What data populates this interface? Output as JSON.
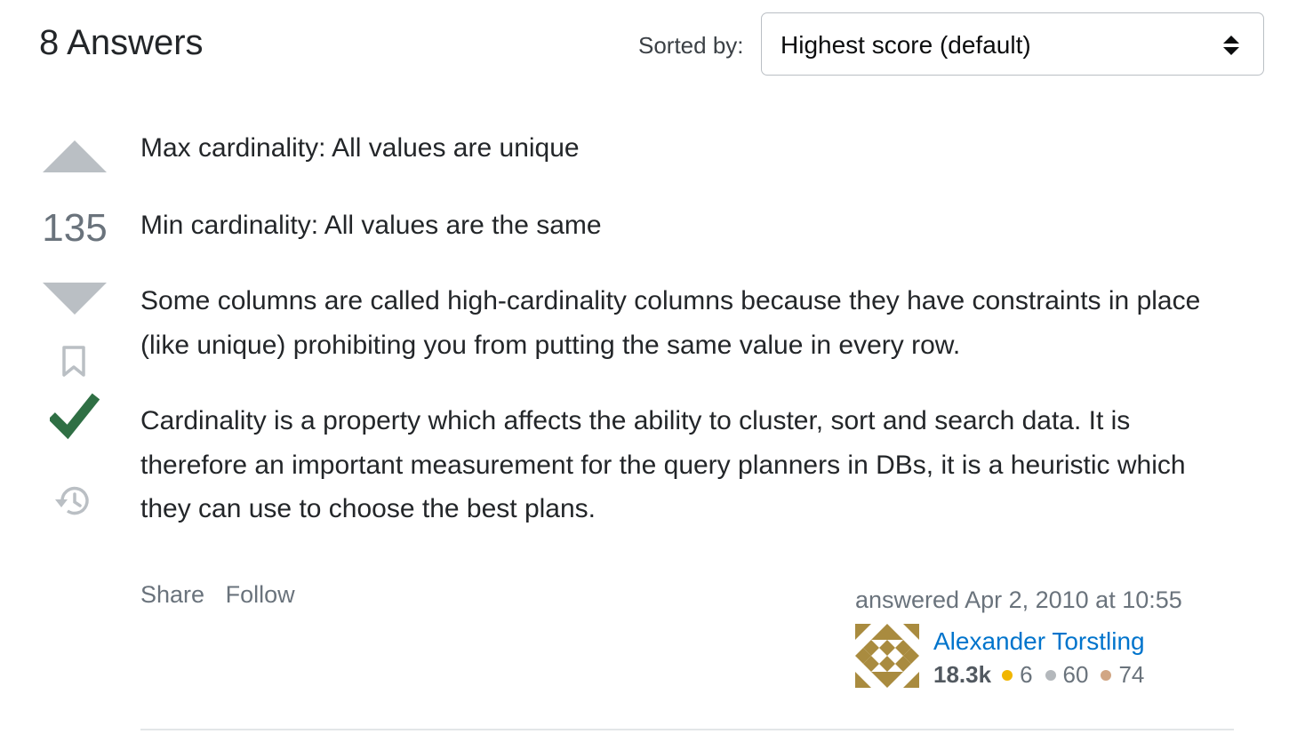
{
  "header": {
    "answers_title": "8 Answers",
    "sort_label": "Sorted by:",
    "sort_value": "Highest score (default)"
  },
  "vote": {
    "count": "135"
  },
  "post": {
    "paragraphs": [
      "Max cardinality: All values are unique",
      "Min cardinality: All values are the same",
      "Some columns are called high-cardinality columns because they have constraints in place (like unique) prohibiting you from putting the same value in every row.",
      "Cardinality is a property which affects the ability to cluster, sort and search data. It is therefore an important measurement for the query planners in DBs, it is a heuristic which they can use to choose the best plans."
    ]
  },
  "menu": {
    "share": "Share",
    "follow": "Follow"
  },
  "user": {
    "answered": "answered Apr 2, 2010 at 10:55",
    "name": "Alexander Torstling",
    "reputation": "18.3k",
    "gold": "6",
    "silver": "60",
    "bronze": "74"
  },
  "colors": {
    "gold": "#f1b600",
    "silver": "#b4b8bc",
    "bronze": "#d1a684",
    "accepted": "#2f6f44",
    "link": "#0074cc",
    "vote_arrow": "#babfc4"
  },
  "icons": {
    "vote_up": "triangle-up-icon",
    "vote_down": "triangle-down-icon",
    "bookmark": "bookmark-icon",
    "accepted": "checkmark-icon",
    "history": "history-icon",
    "sort": "up-down-arrows-icon"
  }
}
